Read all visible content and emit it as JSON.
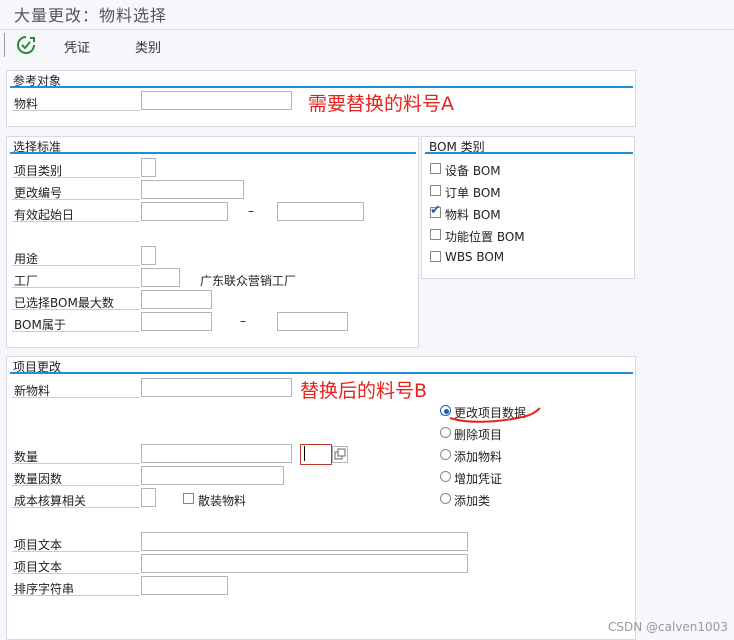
{
  "window": {
    "title": "大量更改：物料选择"
  },
  "toolbar": {
    "check_icon": "execute-check-icon",
    "voucher_label": "凭证",
    "category_label": "类别"
  },
  "ref": {
    "title": "参考对象",
    "material_label": "物料",
    "material_value": ""
  },
  "sel": {
    "title": "选择标准",
    "item_category": "项目类别",
    "change_number": "更改编号",
    "valid_from": "有效起始日",
    "dash1": "–",
    "usage": "用途",
    "plant": "工厂",
    "plant_name": "广东联众营销工厂",
    "max_bom": "已选择BOM最大数",
    "bom_belongs": "BOM属于",
    "dash2": "–"
  },
  "bomtype": {
    "title": "BOM 类别",
    "items": [
      {
        "label": "设备 BOM",
        "checked": false
      },
      {
        "label": "订单 BOM",
        "checked": false
      },
      {
        "label": "物料 BOM",
        "checked": true
      },
      {
        "label": "功能位置 BOM",
        "checked": false
      },
      {
        "label": "WBS BOM",
        "checked": false
      }
    ]
  },
  "itemchange": {
    "title": "项目更改",
    "new_material": "新物料",
    "quantity": "数量",
    "qty_factor": "数量因数",
    "cost_relevant": "成本核算相关",
    "bulk_material": "散装物料",
    "item_text1": "项目文本",
    "item_text2": "项目文本",
    "sort_string": "排序字符串",
    "radios": [
      {
        "label": "更改项目数据",
        "selected": true
      },
      {
        "label": "删除项目",
        "selected": false
      },
      {
        "label": "添加物料",
        "selected": false
      },
      {
        "label": "增加凭证",
        "selected": false
      },
      {
        "label": "添加类",
        "selected": false
      }
    ]
  },
  "annotations": {
    "a": "需要替换的料号A",
    "b": "替换后的料号B",
    "color": "#e8231e"
  },
  "watermark": "CSDN @calven1003"
}
